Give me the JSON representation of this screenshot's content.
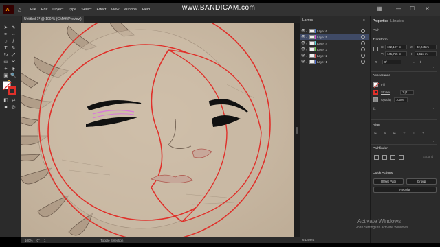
{
  "app": {
    "logo": "Ai",
    "home_icon": "home-icon"
  },
  "menu": [
    "File",
    "Edit",
    "Object",
    "Type",
    "Select",
    "Effect",
    "View",
    "Window",
    "Help"
  ],
  "watermark": "www.BANDICAM.com",
  "document": {
    "tab_title": "Untitled-1* @ 100 % (CMYK/Preview)",
    "tab_close": "×"
  },
  "layers": {
    "title": "Layers",
    "rows": [
      {
        "name": "Layer 6",
        "color": "#4a7bd6",
        "selected": false
      },
      {
        "name": "Layer 5",
        "color": "#d64ad6",
        "selected": true
      },
      {
        "name": "Layer 4",
        "color": "#4ad6d6",
        "selected": false
      },
      {
        "name": "Layer 3",
        "color": "#6ad64a",
        "selected": false
      },
      {
        "name": "Layer 2",
        "color": "#d64a4a",
        "selected": false
      },
      {
        "name": "Layer 1",
        "color": "#4a6ad6",
        "selected": false
      }
    ],
    "footer": "6 Layers"
  },
  "properties": {
    "tabs": [
      "Properties",
      "Libraries"
    ],
    "selection_type": "Path",
    "transform": {
      "title": "Transform",
      "x_label": "X:",
      "x": "162,197 m",
      "w_label": "W:",
      "w": "32,245 m",
      "y_label": "Y:",
      "y": "145,765 m",
      "h_label": "H:",
      "h": "5,616 m",
      "angle": "0°"
    },
    "appearance": {
      "title": "Appearance",
      "fill_label": "Fill",
      "stroke_label": "Stroke",
      "stroke_value": "1 pt",
      "opacity_label": "Opacity",
      "opacity_value": "100%",
      "fx_label": "fx"
    },
    "align": {
      "title": "Align"
    },
    "pathfinder": {
      "title": "Pathfinder",
      "expand": "Expand"
    },
    "quick_actions": {
      "title": "Quick Actions",
      "offset_path": "Offset Path",
      "group": "Group",
      "recolor": "Recolor"
    }
  },
  "status": {
    "zoom": "100%",
    "angle": "0°",
    "artboard": "1",
    "tool": "Toggle Selection"
  },
  "windows_notice": {
    "title": "Activate Windows",
    "subtitle": "Go to Settings to activate Windows."
  },
  "colors": {
    "accent_red": "#e0302a",
    "layer_selected": "#3f4a66"
  }
}
